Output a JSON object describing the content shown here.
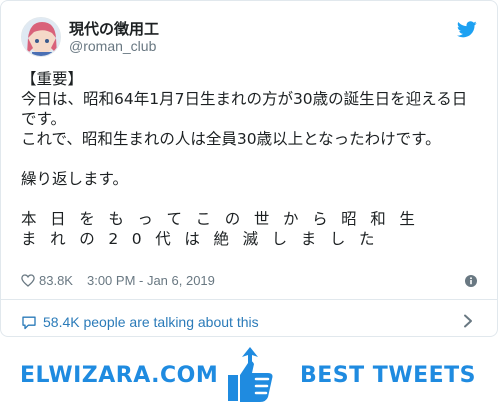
{
  "tweet": {
    "display_name": "現代の徴用工",
    "handle": "@roman_club",
    "lines": [
      "【重要】",
      "今日は、昭和64年1月7日生まれの方が30歳の誕生日を迎える日",
      "です。",
      "これで、昭和生まれの人は全員30歳以上となったわけです。",
      "",
      "繰り返します。",
      "",
      "本 日 を も っ て こ の 世 か ら 昭 和 生",
      "ま れ の 2 0 代 は 絶 滅 し ま し た"
    ],
    "likes": "83.8K",
    "time": "3:00 PM - Jan 6, 2019",
    "talking": "58.4K people are talking about this"
  },
  "banner": {
    "left_text": "ELWIZARA.COM",
    "right_text": "BEST TWEETS"
  },
  "colors": {
    "accent": "#1da1f2",
    "link": "#2b7bb9",
    "banner": "#1f8be0"
  },
  "icons": [
    "twitter-bird-icon",
    "heart-icon",
    "info-icon",
    "speech-bubble-icon",
    "chevron-right-icon",
    "thumbs-up-icon"
  ]
}
